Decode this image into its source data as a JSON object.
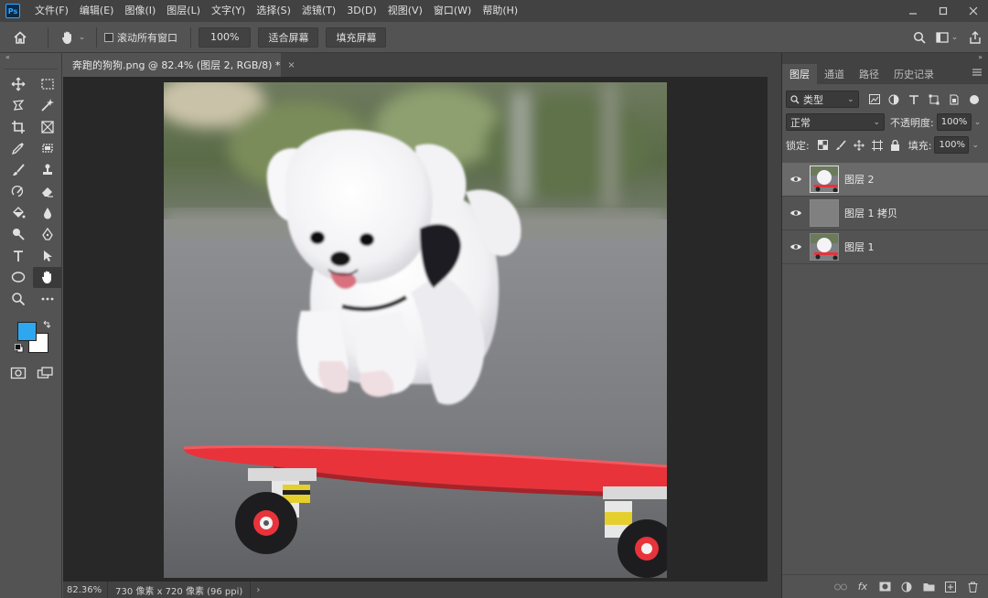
{
  "app": {
    "logo_text": "Ps",
    "menu": [
      "文件(F)",
      "编辑(E)",
      "图像(I)",
      "图层(L)",
      "文字(Y)",
      "选择(S)",
      "滤镜(T)",
      "3D(D)",
      "视图(V)",
      "窗口(W)",
      "帮助(H)"
    ]
  },
  "options_bar": {
    "scroll_all_label": "滚动所有窗口",
    "zoom_value": "100%",
    "fit_screen_label": "适合屏幕",
    "fill_screen_label": "填充屏幕"
  },
  "document": {
    "tab_title": "奔跑的狗狗.png @ 82.4% (图层 2, RGB/8) *",
    "close_glyph": "×"
  },
  "status_bar": {
    "zoom": "82.36%",
    "doc_info": "730 像素 x 720 像素 (96 ppi)",
    "arrow": "›"
  },
  "panel": {
    "collapse_glyph": "»",
    "tabs": [
      "图层",
      "通道",
      "路径",
      "历史记录"
    ],
    "filter_kind": "类型",
    "blend_mode": "正常",
    "opacity_label": "不透明度:",
    "opacity_value": "100%",
    "lock_label": "锁定:",
    "fill_label": "填充:",
    "fill_value": "100%",
    "layers": [
      {
        "name": "图层 2",
        "selected": true,
        "thumb": "dog"
      },
      {
        "name": "图层 1 拷贝",
        "selected": false,
        "thumb": "gray"
      },
      {
        "name": "图层 1",
        "selected": false,
        "thumb": "dog"
      }
    ],
    "footer_fx": "fx"
  },
  "toolbar": {
    "collapse_glyph": "«",
    "tools": [
      "move-tool-icon",
      "marquee-tool-icon",
      "lasso-tool-icon",
      "magic-wand-tool-icon",
      "crop-tool-icon",
      "frame-tool-icon",
      "eyedropper-tool-icon",
      "patch-tool-icon",
      "brush-tool-icon",
      "clone-stamp-tool-icon",
      "history-brush-tool-icon",
      "eraser-tool-icon",
      "paint-bucket-tool-icon",
      "blur-tool-icon",
      "dodge-tool-icon",
      "pen-tool-icon",
      "type-tool-icon",
      "path-selection-tool-icon",
      "ellipse-tool-icon",
      "hand-tool-icon",
      "zoom-tool-icon",
      "more-tools-icon"
    ],
    "foreground_color": "#2fa6f0",
    "background_color": "#ffffff"
  },
  "colors": {
    "accent": "#31a8ff",
    "skateboard": "#e8333b"
  }
}
